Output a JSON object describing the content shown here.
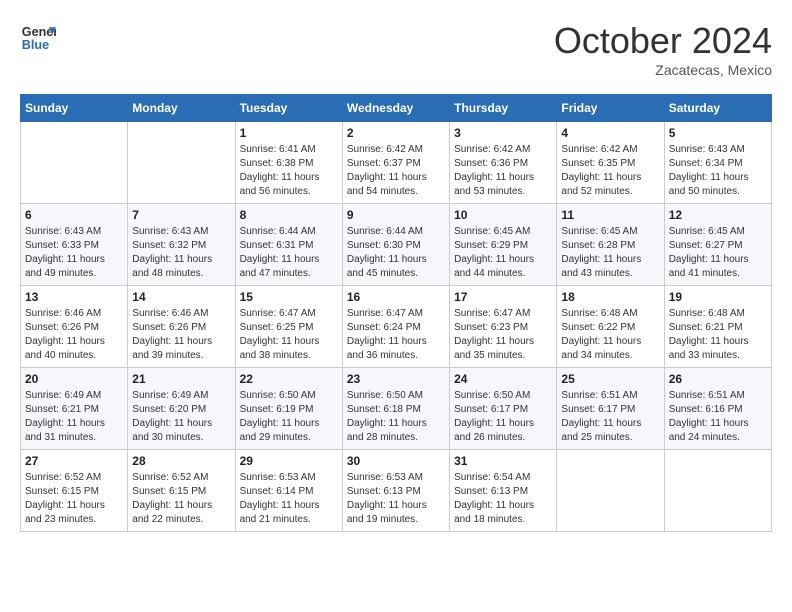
{
  "header": {
    "logo_line1": "General",
    "logo_line2": "Blue",
    "month": "October 2024",
    "location": "Zacatecas, Mexico"
  },
  "days_of_week": [
    "Sunday",
    "Monday",
    "Tuesday",
    "Wednesday",
    "Thursday",
    "Friday",
    "Saturday"
  ],
  "weeks": [
    [
      {
        "day": "",
        "sunrise": "",
        "sunset": "",
        "daylight": ""
      },
      {
        "day": "",
        "sunrise": "",
        "sunset": "",
        "daylight": ""
      },
      {
        "day": "1",
        "sunrise": "Sunrise: 6:41 AM",
        "sunset": "Sunset: 6:38 PM",
        "daylight": "Daylight: 11 hours and 56 minutes."
      },
      {
        "day": "2",
        "sunrise": "Sunrise: 6:42 AM",
        "sunset": "Sunset: 6:37 PM",
        "daylight": "Daylight: 11 hours and 54 minutes."
      },
      {
        "day": "3",
        "sunrise": "Sunrise: 6:42 AM",
        "sunset": "Sunset: 6:36 PM",
        "daylight": "Daylight: 11 hours and 53 minutes."
      },
      {
        "day": "4",
        "sunrise": "Sunrise: 6:42 AM",
        "sunset": "Sunset: 6:35 PM",
        "daylight": "Daylight: 11 hours and 52 minutes."
      },
      {
        "day": "5",
        "sunrise": "Sunrise: 6:43 AM",
        "sunset": "Sunset: 6:34 PM",
        "daylight": "Daylight: 11 hours and 50 minutes."
      }
    ],
    [
      {
        "day": "6",
        "sunrise": "Sunrise: 6:43 AM",
        "sunset": "Sunset: 6:33 PM",
        "daylight": "Daylight: 11 hours and 49 minutes."
      },
      {
        "day": "7",
        "sunrise": "Sunrise: 6:43 AM",
        "sunset": "Sunset: 6:32 PM",
        "daylight": "Daylight: 11 hours and 48 minutes."
      },
      {
        "day": "8",
        "sunrise": "Sunrise: 6:44 AM",
        "sunset": "Sunset: 6:31 PM",
        "daylight": "Daylight: 11 hours and 47 minutes."
      },
      {
        "day": "9",
        "sunrise": "Sunrise: 6:44 AM",
        "sunset": "Sunset: 6:30 PM",
        "daylight": "Daylight: 11 hours and 45 minutes."
      },
      {
        "day": "10",
        "sunrise": "Sunrise: 6:45 AM",
        "sunset": "Sunset: 6:29 PM",
        "daylight": "Daylight: 11 hours and 44 minutes."
      },
      {
        "day": "11",
        "sunrise": "Sunrise: 6:45 AM",
        "sunset": "Sunset: 6:28 PM",
        "daylight": "Daylight: 11 hours and 43 minutes."
      },
      {
        "day": "12",
        "sunrise": "Sunrise: 6:45 AM",
        "sunset": "Sunset: 6:27 PM",
        "daylight": "Daylight: 11 hours and 41 minutes."
      }
    ],
    [
      {
        "day": "13",
        "sunrise": "Sunrise: 6:46 AM",
        "sunset": "Sunset: 6:26 PM",
        "daylight": "Daylight: 11 hours and 40 minutes."
      },
      {
        "day": "14",
        "sunrise": "Sunrise: 6:46 AM",
        "sunset": "Sunset: 6:26 PM",
        "daylight": "Daylight: 11 hours and 39 minutes."
      },
      {
        "day": "15",
        "sunrise": "Sunrise: 6:47 AM",
        "sunset": "Sunset: 6:25 PM",
        "daylight": "Daylight: 11 hours and 38 minutes."
      },
      {
        "day": "16",
        "sunrise": "Sunrise: 6:47 AM",
        "sunset": "Sunset: 6:24 PM",
        "daylight": "Daylight: 11 hours and 36 minutes."
      },
      {
        "day": "17",
        "sunrise": "Sunrise: 6:47 AM",
        "sunset": "Sunset: 6:23 PM",
        "daylight": "Daylight: 11 hours and 35 minutes."
      },
      {
        "day": "18",
        "sunrise": "Sunrise: 6:48 AM",
        "sunset": "Sunset: 6:22 PM",
        "daylight": "Daylight: 11 hours and 34 minutes."
      },
      {
        "day": "19",
        "sunrise": "Sunrise: 6:48 AM",
        "sunset": "Sunset: 6:21 PM",
        "daylight": "Daylight: 11 hours and 33 minutes."
      }
    ],
    [
      {
        "day": "20",
        "sunrise": "Sunrise: 6:49 AM",
        "sunset": "Sunset: 6:21 PM",
        "daylight": "Daylight: 11 hours and 31 minutes."
      },
      {
        "day": "21",
        "sunrise": "Sunrise: 6:49 AM",
        "sunset": "Sunset: 6:20 PM",
        "daylight": "Daylight: 11 hours and 30 minutes."
      },
      {
        "day": "22",
        "sunrise": "Sunrise: 6:50 AM",
        "sunset": "Sunset: 6:19 PM",
        "daylight": "Daylight: 11 hours and 29 minutes."
      },
      {
        "day": "23",
        "sunrise": "Sunrise: 6:50 AM",
        "sunset": "Sunset: 6:18 PM",
        "daylight": "Daylight: 11 hours and 28 minutes."
      },
      {
        "day": "24",
        "sunrise": "Sunrise: 6:50 AM",
        "sunset": "Sunset: 6:17 PM",
        "daylight": "Daylight: 11 hours and 26 minutes."
      },
      {
        "day": "25",
        "sunrise": "Sunrise: 6:51 AM",
        "sunset": "Sunset: 6:17 PM",
        "daylight": "Daylight: 11 hours and 25 minutes."
      },
      {
        "day": "26",
        "sunrise": "Sunrise: 6:51 AM",
        "sunset": "Sunset: 6:16 PM",
        "daylight": "Daylight: 11 hours and 24 minutes."
      }
    ],
    [
      {
        "day": "27",
        "sunrise": "Sunrise: 6:52 AM",
        "sunset": "Sunset: 6:15 PM",
        "daylight": "Daylight: 11 hours and 23 minutes."
      },
      {
        "day": "28",
        "sunrise": "Sunrise: 6:52 AM",
        "sunset": "Sunset: 6:15 PM",
        "daylight": "Daylight: 11 hours and 22 minutes."
      },
      {
        "day": "29",
        "sunrise": "Sunrise: 6:53 AM",
        "sunset": "Sunset: 6:14 PM",
        "daylight": "Daylight: 11 hours and 21 minutes."
      },
      {
        "day": "30",
        "sunrise": "Sunrise: 6:53 AM",
        "sunset": "Sunset: 6:13 PM",
        "daylight": "Daylight: 11 hours and 19 minutes."
      },
      {
        "day": "31",
        "sunrise": "Sunrise: 6:54 AM",
        "sunset": "Sunset: 6:13 PM",
        "daylight": "Daylight: 11 hours and 18 minutes."
      },
      {
        "day": "",
        "sunrise": "",
        "sunset": "",
        "daylight": ""
      },
      {
        "day": "",
        "sunrise": "",
        "sunset": "",
        "daylight": ""
      }
    ]
  ]
}
